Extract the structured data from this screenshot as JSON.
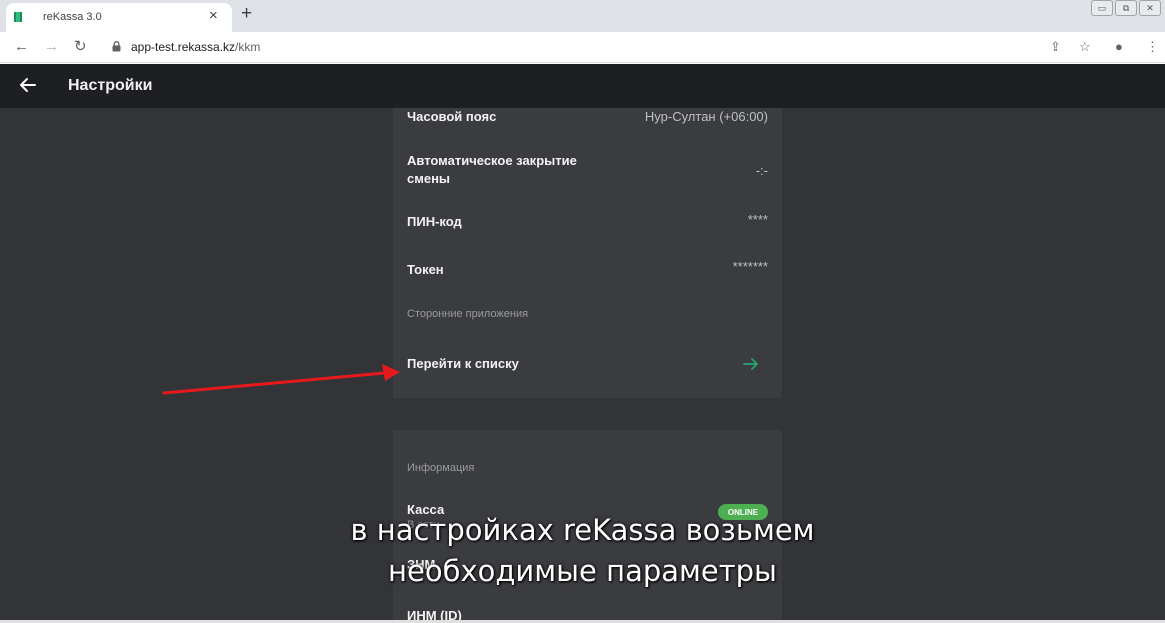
{
  "browser": {
    "tab_title": "reKassa 3.0",
    "tab_close": "×",
    "new_tab": "+",
    "url_host": "app-test.rekassa.kz",
    "url_path": "/kkm",
    "win_controls": [
      "▭",
      "⧉",
      "✕"
    ]
  },
  "header": {
    "title": "Настройки"
  },
  "settings": [
    {
      "label": "Часовой пояс",
      "value": "Нур-Султан (+06:00)"
    },
    {
      "label": "Автоматическое закрытие смены",
      "value": "-:-"
    },
    {
      "label": "ПИН-код",
      "value": "****"
    },
    {
      "label": "Токен",
      "value": "*******"
    }
  ],
  "third_party": {
    "section_title": "Сторонние приложения",
    "link_label": "Перейти к списку"
  },
  "info": {
    "section_title": "Информация",
    "kassa_label": "Касса",
    "kassa_status": "В сети",
    "kassa_badge": "ONLINE",
    "znm_label": "ЗНМ",
    "inm_label": "ИНМ (ID)"
  },
  "subtitle": {
    "line1": "в настройках reKassa возьмем",
    "line2": "необходимые параметры"
  },
  "colors": {
    "header_bg": "#1e1f22",
    "body_bg": "#333438",
    "card_bg": "#3b3c40",
    "accent_green": "#26a671",
    "badge_green": "#4caf50",
    "annotation_red": "#e8191c"
  }
}
